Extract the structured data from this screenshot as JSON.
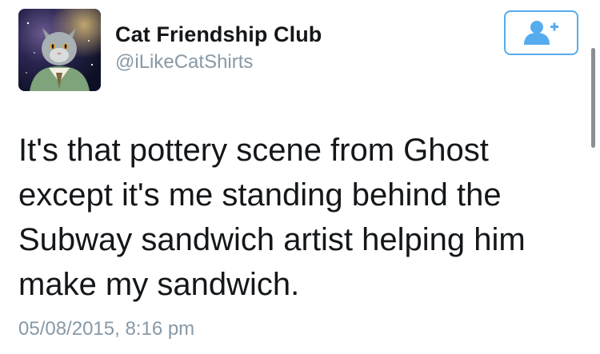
{
  "user": {
    "display_name": "Cat Friendship Club",
    "handle": "@iLikeCatShirts",
    "avatar_icon": "cat-in-sweater-avatar"
  },
  "follow_button": {
    "icon": "add-user-icon",
    "color": "#55acee"
  },
  "tweet": {
    "text": "It's that pottery scene from Ghost\nexcept it's me standing behind the\nSubway sandwich artist helping him\nmake my sandwich.",
    "timestamp": "05/08/2015, 8:16 pm"
  },
  "colors": {
    "name": "#14171a",
    "secondary": "#8899a6",
    "accent": "#55acee"
  }
}
